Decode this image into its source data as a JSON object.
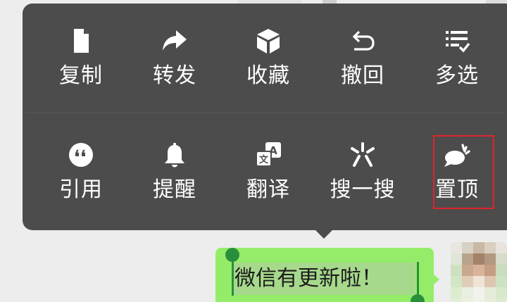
{
  "menu": {
    "row1": [
      {
        "label": "复制",
        "icon": "document-icon"
      },
      {
        "label": "转发",
        "icon": "forward-arrow-icon"
      },
      {
        "label": "收藏",
        "icon": "cube-icon"
      },
      {
        "label": "撤回",
        "icon": "undo-icon"
      },
      {
        "label": "多选",
        "icon": "multi-select-icon"
      }
    ],
    "row2": [
      {
        "label": "引用",
        "icon": "quote-icon"
      },
      {
        "label": "提醒",
        "icon": "bell-icon"
      },
      {
        "label": "翻译",
        "icon": "translate-icon"
      },
      {
        "label": "搜一搜",
        "icon": "search-spark-icon"
      },
      {
        "label": "置顶",
        "icon": "pin-bubble-icon"
      }
    ]
  },
  "message": {
    "text": "微信有更新啦！"
  },
  "colors": {
    "menu_bg": "#4c4c4c",
    "bubble_bg": "#95ec69",
    "highlight": "#e0232b",
    "selection_handle": "#2a8f3b"
  }
}
